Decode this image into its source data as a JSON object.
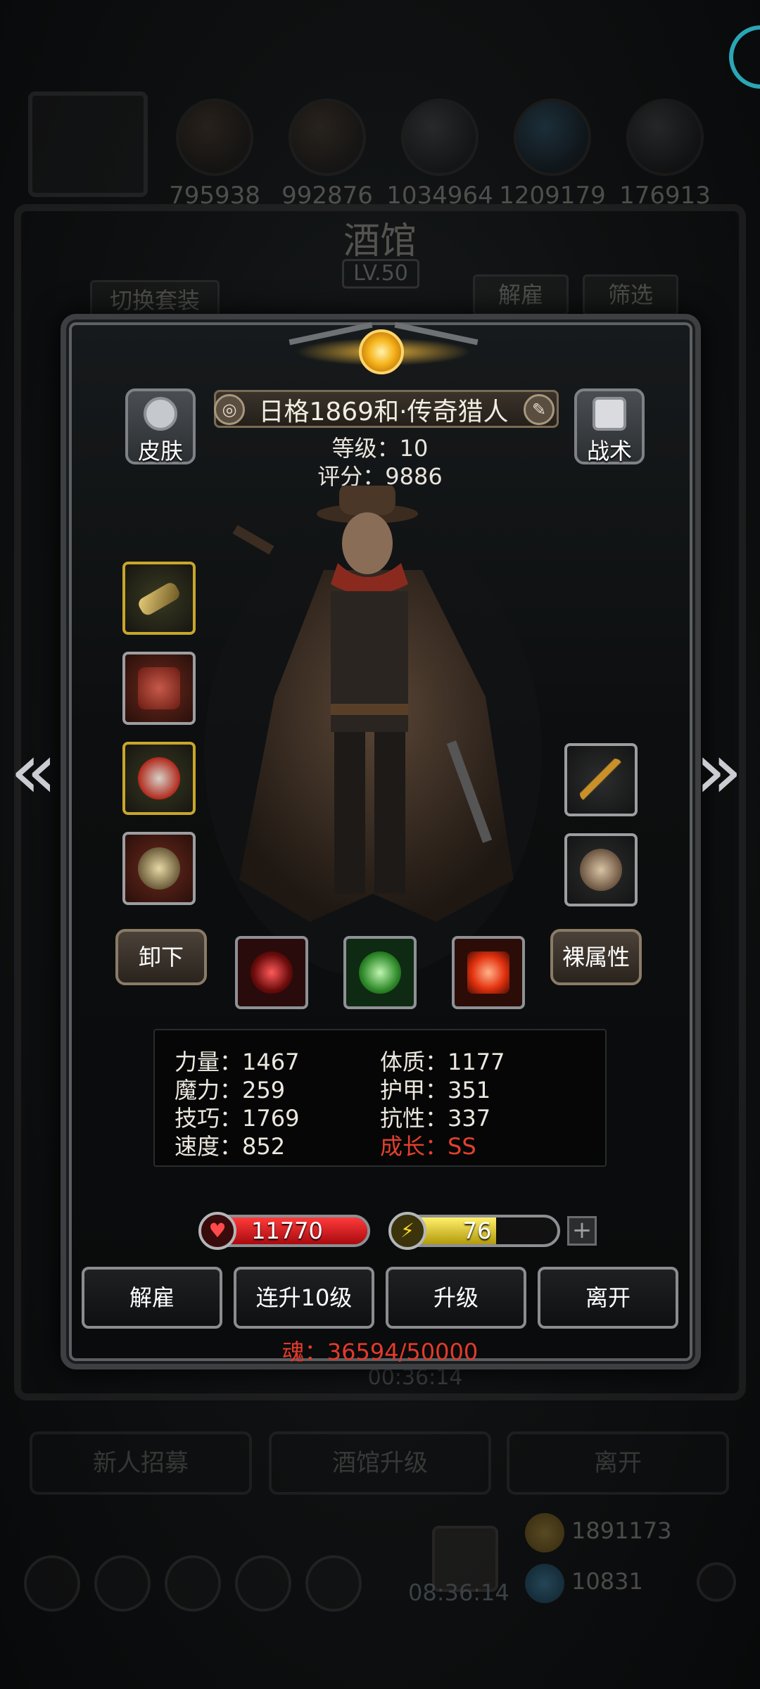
{
  "background": {
    "resources": [
      "795938",
      "992876",
      "1034964",
      "1209179",
      "176913"
    ],
    "title": "酒馆",
    "level": "LV.50",
    "switch_outfit": "切换套装",
    "dismiss": "解雇",
    "filter": "筛选",
    "timer_small": "00:36:14",
    "bottom_buttons": [
      "新人招募",
      "酒馆升级",
      "离开"
    ],
    "gold": "1891173",
    "gems": "10831",
    "timer_large": "08:36:14"
  },
  "hero": {
    "name": "日格1869和·传奇猎人",
    "level_label": "等级：10",
    "score_label": "评分：9886",
    "skin_label": "皮肤",
    "tactics_label": "战术",
    "unequip_label": "卸下",
    "base_attr_label": "裸属性"
  },
  "stats": {
    "strength": "力量：1467",
    "magic": "魔力：259",
    "skill": "技巧：1769",
    "speed": "速度：852",
    "constitution": "体质：1177",
    "armor": "护甲：351",
    "resistance": "抗性：337",
    "growth": "成长：SS"
  },
  "bars": {
    "hp_value": "11770",
    "energy_value": "76",
    "energy_fraction": 0.62
  },
  "actions": [
    "解雇",
    "连升10级",
    "升级",
    "离开"
  ],
  "soul": "魂：36594/50000",
  "icons": {
    "prev": "«",
    "next": "»",
    "heart": "♥",
    "bolt": "⚡",
    "plus": "+",
    "edit": "✎",
    "badge": "◎"
  },
  "colors": {
    "hp": "#d4141a",
    "energy": "#e3d018",
    "accent_gold": "#f6b41b",
    "growth_red": "#e3402d"
  }
}
